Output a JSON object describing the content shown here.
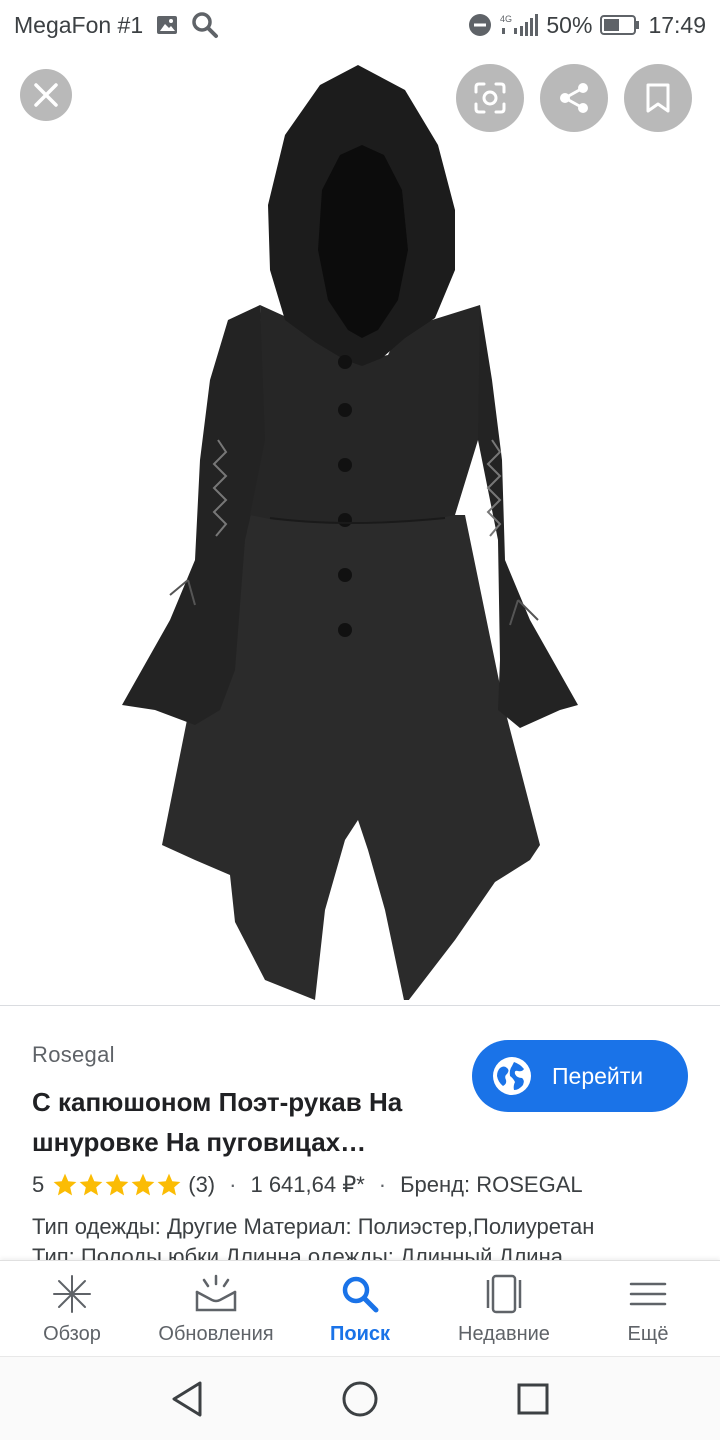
{
  "status_bar": {
    "carrier": "MegaFon #1",
    "network": "4G",
    "battery": "50%",
    "time": "17:49"
  },
  "product": {
    "source": "Rosegal",
    "title": "С капюшоном Поэт-рукав На шнуровке На пуговицах…",
    "rating": "5",
    "reviews": "(3)",
    "price": "1 641,64 ₽*",
    "brand": "Бренд: ROSEGAL",
    "desc_line1": "Тип одежды: Другие Материал: Полиэстер,Полиуретан",
    "desc_line2": "Тип: Полоды юбки Длинна одежды: Длинный Длина",
    "visit_label": "Перейти"
  },
  "bottom_nav": {
    "items": [
      {
        "label": "Обзор",
        "icon": "asterisk-icon"
      },
      {
        "label": "Обновления",
        "icon": "updates-icon"
      },
      {
        "label": "Поиск",
        "icon": "search-icon"
      },
      {
        "label": "Недавние",
        "icon": "recent-icon"
      },
      {
        "label": "Ещё",
        "icon": "menu-icon"
      }
    ],
    "active_index": 2
  },
  "colors": {
    "accent": "#1a73e8",
    "star": "#fbbc04"
  }
}
